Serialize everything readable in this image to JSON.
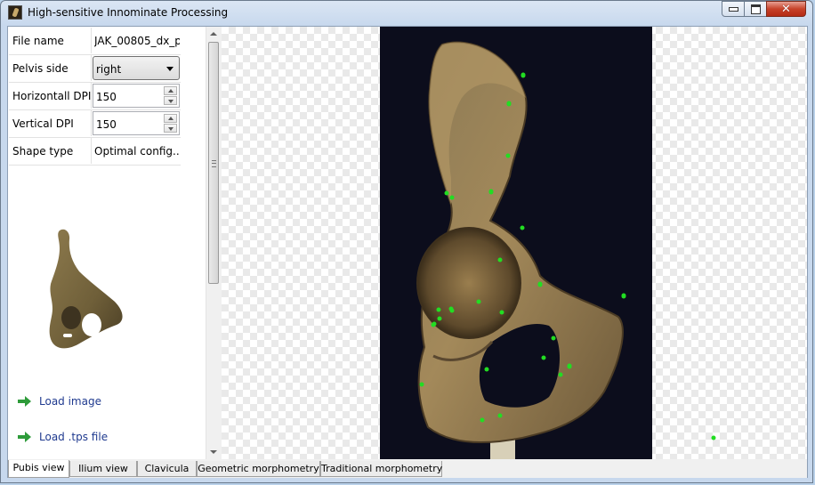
{
  "window": {
    "title": "High-sensitive Innominate Processing"
  },
  "properties": [
    {
      "label": "File name",
      "value": "JAK_00805_dx_p..."
    },
    {
      "label": "Pelvis side",
      "value": "right"
    },
    {
      "label": "Horizontall DPI",
      "value": "150"
    },
    {
      "label": "Vertical DPI",
      "value": "150"
    },
    {
      "label": "Shape type",
      "value": "Optimal config..."
    }
  ],
  "actions": [
    {
      "label": "Load image"
    },
    {
      "label": "Load .tps file"
    }
  ],
  "tabs": [
    {
      "label": "Pubis view",
      "active": true
    },
    {
      "label": "Ilium view",
      "active": false
    },
    {
      "label": "Clavicula",
      "active": false
    },
    {
      "label": "Geometric morphometry",
      "active": false
    },
    {
      "label": "Traditional morphometry",
      "active": false
    }
  ],
  "colors": {
    "landmark": "#22dd22",
    "bone": "#a88b5a",
    "photo_background": "#0c0d1c"
  },
  "landmark_count": 33
}
